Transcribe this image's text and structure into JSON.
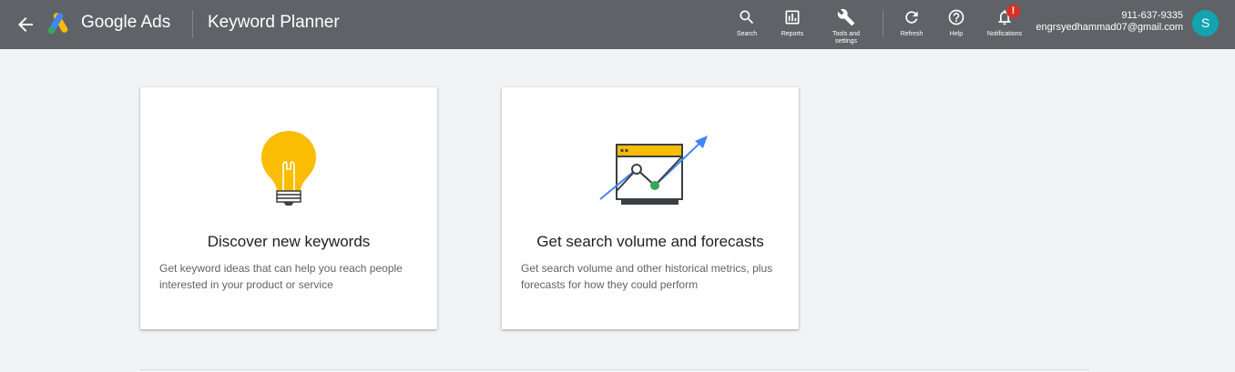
{
  "header": {
    "brand": "Google Ads",
    "title": "Keyword Planner",
    "tools": [
      {
        "label": "Search",
        "icon": "search-icon"
      },
      {
        "label": "Reports",
        "icon": "reports-icon"
      },
      {
        "label": "Tools and settings",
        "icon": "wrench-icon"
      },
      {
        "label": "Refresh",
        "icon": "refresh-icon"
      },
      {
        "label": "Help",
        "icon": "help-icon"
      },
      {
        "label": "Notifications",
        "icon": "bell-icon"
      }
    ],
    "notification_badge": "!",
    "account": {
      "phone": "911-637-9335",
      "email": "engrsyedhammad07@gmail.com",
      "avatar_letter": "S"
    }
  },
  "cards": [
    {
      "title": "Discover new keywords",
      "description": "Get keyword ideas that can help you reach people interested in your product or service",
      "icon": "lightbulb-icon"
    },
    {
      "title": "Get search volume and forecasts",
      "description": "Get search volume and other historical metrics, plus forecasts for how they could perform",
      "icon": "forecast-chart-icon"
    }
  ],
  "colors": {
    "topbar": "#5f6368",
    "background": "#f1f3f4",
    "bulb": "#fbbc04",
    "arrow": "#4285f4",
    "point": "#34a853",
    "avatar": "#12a4af",
    "badge": "#d93025"
  }
}
